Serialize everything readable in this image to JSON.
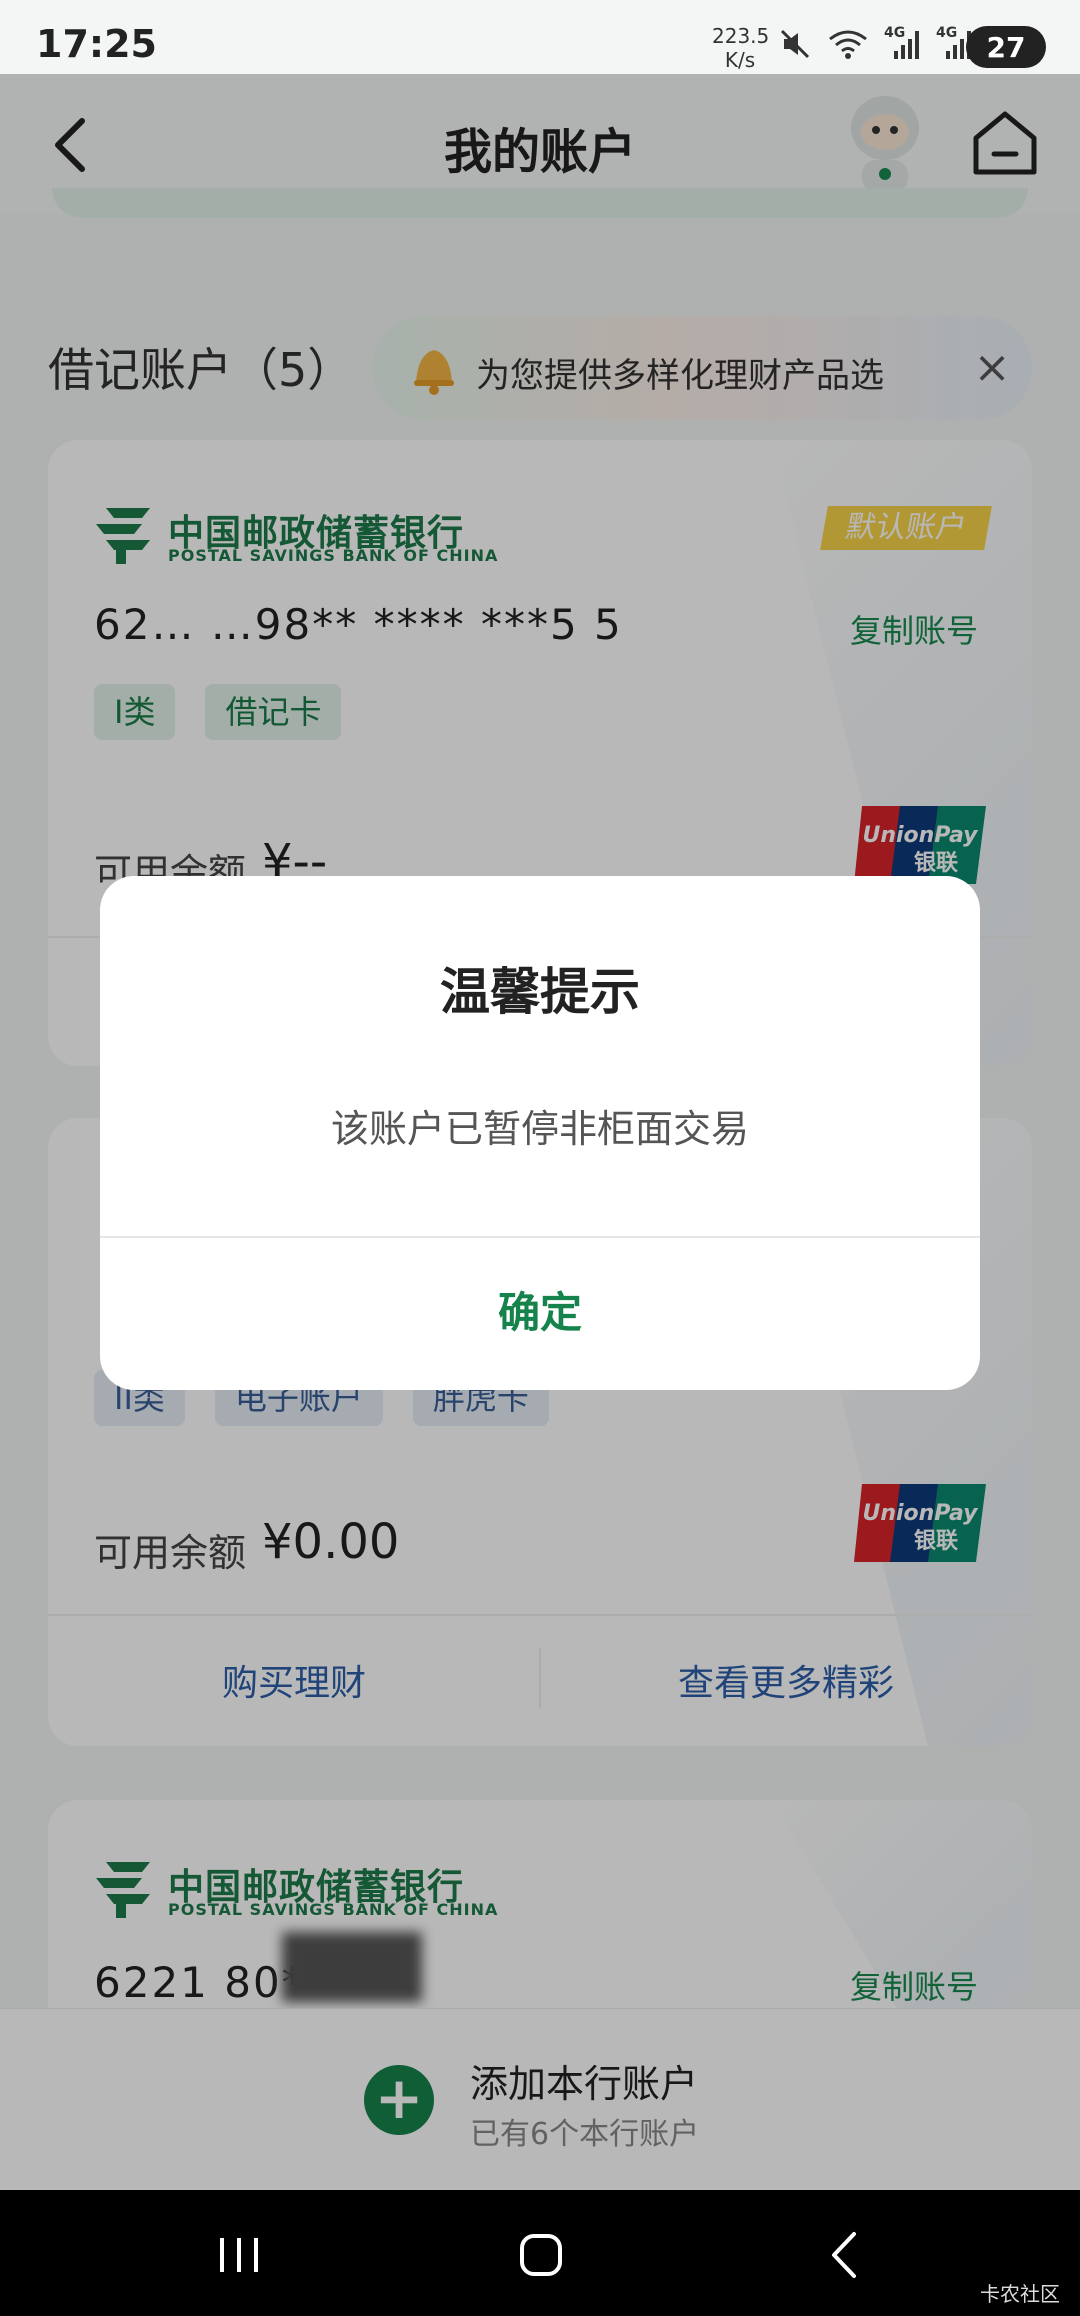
{
  "status_bar": {
    "time": "17:25",
    "speed_value": "223.5",
    "speed_unit": "K/s",
    "signal1": "4G",
    "signal2": "4G",
    "battery": "27"
  },
  "header": {
    "title": "我的账户"
  },
  "section": {
    "title": "借记账户（5）"
  },
  "promo": {
    "text": "为您提供多样化理财产品选"
  },
  "cards": [
    {
      "bank_cn": "中国邮政储蓄银行",
      "bank_en": "POSTAL SAVINGS BANK OF CHINA",
      "default_badge": "默认账户",
      "account_number": "62… …98** ****  ***5  5",
      "copy_label": "复制账号",
      "tags": [
        "I类",
        "借记卡"
      ],
      "balance_label": "可用余额",
      "balance_value": "¥--"
    },
    {
      "tags": [
        "II类",
        "电子账户",
        "胖虎卡"
      ],
      "balance_label": "可用余额",
      "balance_value": "¥0.00",
      "action_left": "购买理财",
      "action_right": "查看更多精彩"
    },
    {
      "bank_cn": "中国邮政储蓄银行",
      "bank_en": "POSTAL SAVINGS BANK OF CHINA",
      "account_number": "6221 80**",
      "copy_label": "复制账号"
    }
  ],
  "unionpay_label": {
    "line1": "UnionPay",
    "line2": "银联"
  },
  "add_account": {
    "title": "添加本行账户",
    "subtitle": "已有6个本行账户"
  },
  "dialog": {
    "title": "温馨提示",
    "message": "该账户已暂停非柜面交易",
    "confirm": "确定"
  },
  "watermark": "卡农社区",
  "colors": {
    "brand_green": "#15834b",
    "link_blue": "#2d5fa8",
    "badge_yellow": "#f7d24a"
  }
}
